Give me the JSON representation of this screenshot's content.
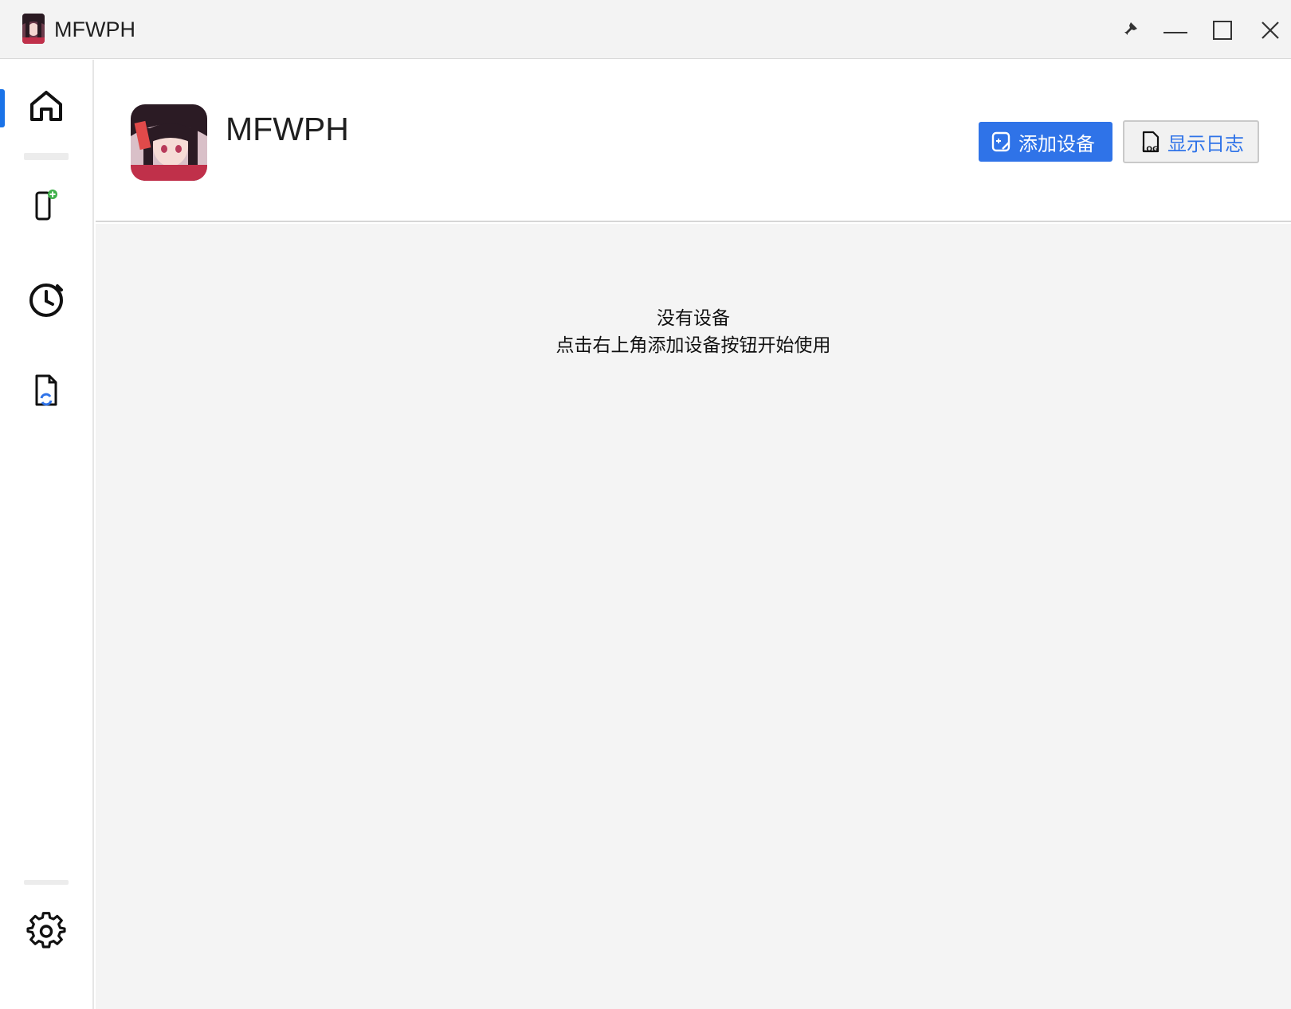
{
  "window": {
    "title": "MFWPH"
  },
  "titlebar_controls": {
    "pin_icon": "pin-icon",
    "minimize_icon": "minimize-icon",
    "maximize_icon": "maximize-icon",
    "close_icon": "close-icon"
  },
  "sidebar": {
    "active_index": 0,
    "items": [
      {
        "icon": "home-icon"
      },
      {
        "icon": "add-device-icon"
      },
      {
        "icon": "clock-icon"
      },
      {
        "icon": "file-refresh-icon"
      }
    ],
    "bottom_item": {
      "icon": "gear-icon"
    }
  },
  "header": {
    "title": "MFWPH",
    "add_device_label": "添加设备",
    "show_log_label": "显示日志"
  },
  "empty_state": {
    "line1": "没有设备",
    "line2": "点击右上角添加设备按钮开始使用"
  },
  "colors": {
    "accent": "#2f73e8",
    "active_indicator": "#1a73e8",
    "titlebar_bg": "#f3f3f3",
    "content_bg": "#f4f4f4"
  }
}
